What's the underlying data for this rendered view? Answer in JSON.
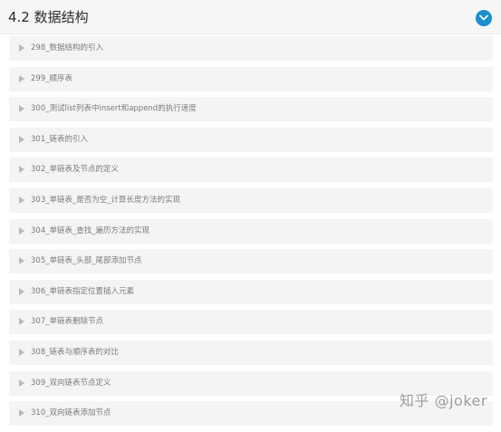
{
  "section": {
    "title": "4.2 数据结构",
    "toggle_icon": "chevron-down-icon",
    "accent_color": "#1a8fd0"
  },
  "lessons": [
    {
      "label": "298_数据结构的引入"
    },
    {
      "label": "299_顺序表"
    },
    {
      "label": "300_测试list列表中insert和append的执行速度"
    },
    {
      "label": "301_链表的引入"
    },
    {
      "label": "302_单链表及节点的定义"
    },
    {
      "label": "303_单链表_是否为空_计算长度方法的实现"
    },
    {
      "label": "304_单链表_查找_遍历方法的实现"
    },
    {
      "label": "305_单链表_头部_尾部添加节点"
    },
    {
      "label": "306_单链表指定位置插入元素"
    },
    {
      "label": "307_单链表删除节点"
    },
    {
      "label": "308_链表与顺序表的对比"
    },
    {
      "label": "309_双向链表节点定义"
    },
    {
      "label": "310_双向链表添加节点"
    }
  ],
  "watermark": {
    "text": "知乎 @joker"
  }
}
